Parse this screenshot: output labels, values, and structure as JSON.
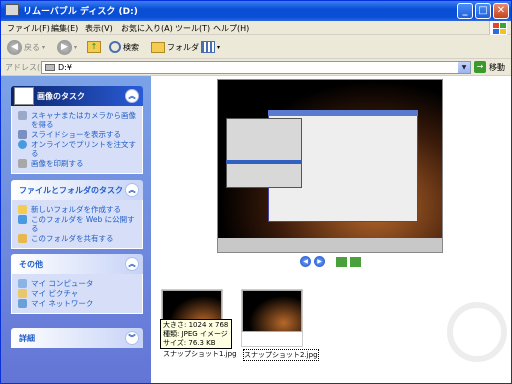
{
  "window": {
    "title": "リムーバブル ディスク (D:)",
    "min": "_",
    "max": "□",
    "close": "✕"
  },
  "menu": [
    "ファイル(F)",
    "編集(E)",
    "表示(V)",
    "お気に入り(A)",
    "ツール(T)",
    "ヘルプ(H)"
  ],
  "toolbar": {
    "back": "戻る",
    "search": "検索",
    "folder": "フォルダ"
  },
  "address": {
    "label": "アドレス(D)",
    "value": "D:¥",
    "go": "移動"
  },
  "panels": {
    "image_tasks": {
      "title": "画像のタスク",
      "items": [
        "スキャナまたはカメラから画像を得る",
        "スライドショーを表示する",
        "オンラインでプリントを注文する",
        "画像を印刷する"
      ]
    },
    "file_tasks": {
      "title": "ファイルとフォルダのタスク",
      "items": [
        "新しいフォルダを作成する",
        "このフォルダを Web に公開する",
        "このフォルダを共有する"
      ]
    },
    "other": {
      "title": "その他",
      "items": [
        "マイ コンピュータ",
        "マイ ピクチャ",
        "マイ ネットワーク"
      ]
    },
    "details": {
      "title": "詳細"
    }
  },
  "files": [
    {
      "name": "スナップショット1.jpg"
    },
    {
      "name": "スナップショット2.jpg"
    }
  ],
  "tooltip": {
    "size_dim": "大きさ: 1024 x 768",
    "type": "種類: JPEG イメージ",
    "filesize": "サイズ: 76.3 KB"
  },
  "colors": {
    "titlebar": "#0a4ed6",
    "sidebar": "#7ba2e7",
    "link": "#215dc6"
  }
}
